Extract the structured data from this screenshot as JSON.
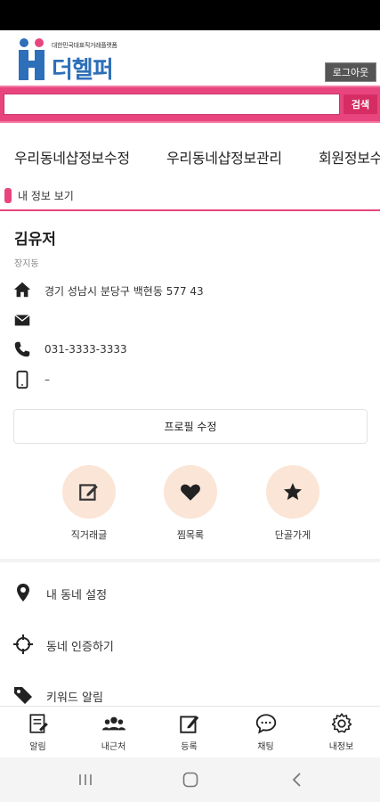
{
  "header": {
    "logo_tagline": "대한민국대표직거래플랫폼",
    "logo_name": "더헬퍼",
    "logout_label": "로그아웃"
  },
  "search": {
    "placeholder": "",
    "value": "",
    "button_label": "검색"
  },
  "menu_tabs": [
    {
      "label": "우리동네샵정보수정"
    },
    {
      "label": "우리동네샵정보관리"
    },
    {
      "label": "회원정보수정"
    }
  ],
  "section": {
    "title": "내 정보 보기"
  },
  "profile": {
    "name": "김유저",
    "area": "장지동",
    "address": "경기 성남시 분당구 백현동 577 43",
    "email": "",
    "phone": "031-3333-3333",
    "mobile": "–",
    "edit_label": "프로필 수정"
  },
  "quick_actions": [
    {
      "label": "직거래글",
      "icon": "write-icon"
    },
    {
      "label": "찜목록",
      "icon": "heart-icon"
    },
    {
      "label": "단골가게",
      "icon": "star-icon"
    }
  ],
  "settings": [
    {
      "label": "내 동네 설정",
      "icon": "map-pin-icon"
    },
    {
      "label": "동네 인증하기",
      "icon": "crosshair-icon"
    },
    {
      "label": "키워드 알림",
      "icon": "tag-icon"
    }
  ],
  "bottom_nav": [
    {
      "label": "알림",
      "icon": "notice-icon"
    },
    {
      "label": "내근처",
      "icon": "people-icon"
    },
    {
      "label": "등록",
      "icon": "edit-icon"
    },
    {
      "label": "채팅",
      "icon": "chat-icon"
    },
    {
      "label": "내정보",
      "icon": "gear-icon"
    }
  ],
  "colors": {
    "accent": "#e8457f",
    "brand_blue": "#2d6fb8",
    "quick_bg": "#fbe5d6"
  }
}
